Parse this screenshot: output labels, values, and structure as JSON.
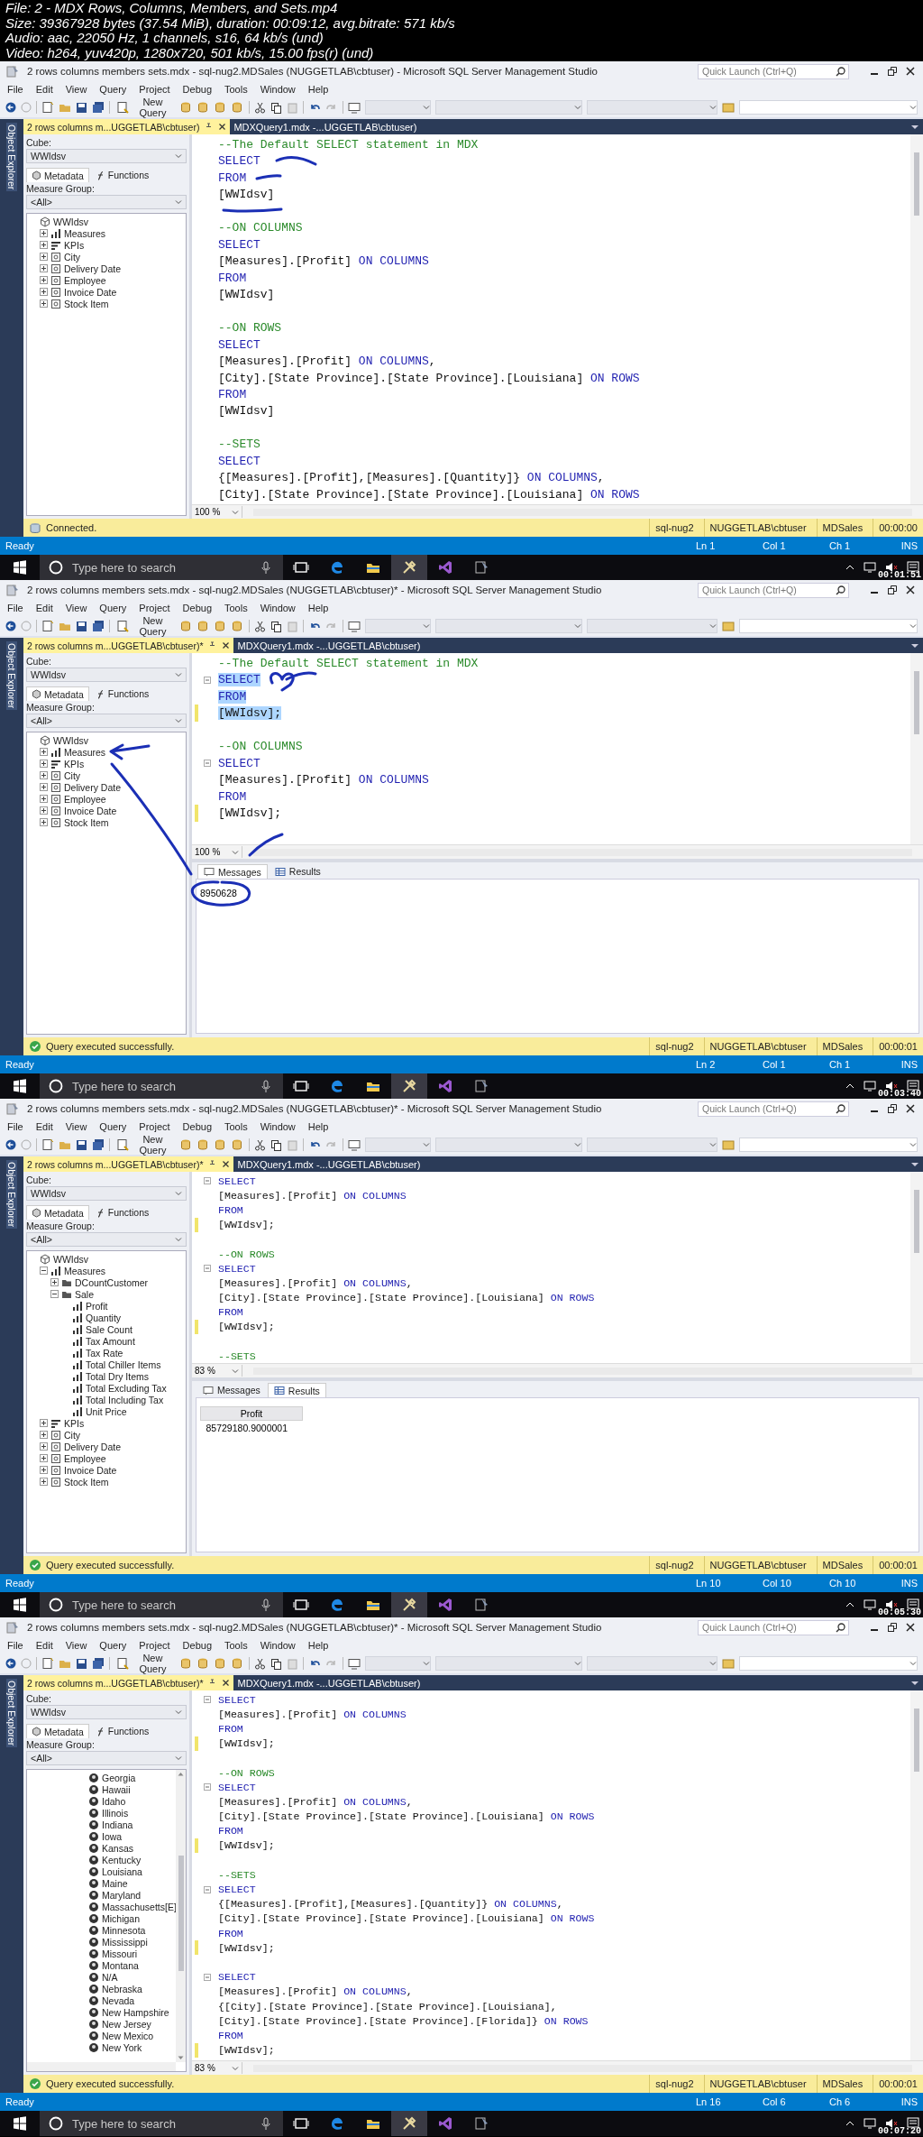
{
  "file_info": [
    "File: 2 - MDX Rows, Columns, Members, and Sets.mp4",
    "Size: 39367928 bytes (37.54 MiB), duration: 00:09:12, avg.bitrate: 571 kb/s",
    "Audio: aac, 22050 Hz, 1 channels, s16, 64 kb/s (und)",
    "Video: h264, yuv420p, 1280x720, 501 kb/s, 15.00 fps(r) (und)"
  ],
  "frames": [
    {
      "pen_marks": {
        "kind": "underlines"
      },
      "title": "2 rows columns members sets.mdx - sql-nug2.MDSales (NUGGETLAB\\cbtuser) - Microsoft SQL Server Management Studio",
      "quick_launch": {
        "placeholder": "Quick Launch (Ctrl+Q)"
      },
      "menu": [
        "File",
        "Edit",
        "View",
        "Query",
        "Project",
        "Debug",
        "Tools",
        "Window",
        "Help"
      ],
      "new_query": "New Query",
      "side_strip": "Object Explorer",
      "tabs": [
        {
          "label": "2 rows columns m...UGGETLAB\\cbtuser)",
          "selected": true
        },
        {
          "label": "MDXQuery1.mdx -...UGGETLAB\\cbtuser)",
          "selected": false
        }
      ],
      "panel": {
        "cube_label": "Cube:",
        "cube": "WWIdsv",
        "tabs": [
          {
            "label": "Metadata",
            "selected": true
          },
          {
            "label": "Functions",
            "selected": false
          }
        ],
        "group_label": "Measure Group:",
        "group": "<All>",
        "tree": [
          {
            "label": "WWIdsv",
            "kind": "cube",
            "children": [
              {
                "label": "Measures",
                "kind": "measures",
                "expanded": false
              },
              {
                "label": "KPIs",
                "kind": "kpi",
                "expanded": false
              },
              {
                "label": "City",
                "kind": "dimension",
                "expanded": false
              },
              {
                "label": "Delivery Date",
                "kind": "dimension",
                "expanded": false
              },
              {
                "label": "Employee",
                "kind": "dimension",
                "expanded": false
              },
              {
                "label": "Invoice Date",
                "kind": "dimension",
                "expanded": false
              },
              {
                "label": "Stock Item",
                "kind": "dimension",
                "expanded": false
              }
            ]
          }
        ]
      },
      "editor": {
        "zoom": "100 %",
        "lines": [
          {
            "kind": "code",
            "segments": [
              {
                "kind": "comment",
                "text": "--The Default SELECT statement in MDX"
              }
            ]
          },
          {
            "kind": "code",
            "segments": [
              {
                "kind": "keyword",
                "text": "SELECT"
              }
            ]
          },
          {
            "kind": "code",
            "segments": [
              {
                "kind": "keyword",
                "text": "FROM"
              }
            ]
          },
          {
            "kind": "code",
            "segments": [
              {
                "kind": "text",
                "text": "[WWIdsv]"
              }
            ]
          },
          {
            "kind": "blank"
          },
          {
            "kind": "code",
            "segments": [
              {
                "kind": "comment",
                "text": "--ON COLUMNS"
              }
            ]
          },
          {
            "kind": "code",
            "segments": [
              {
                "kind": "keyword",
                "text": "SELECT"
              }
            ]
          },
          {
            "kind": "code",
            "segments": [
              {
                "kind": "text",
                "text": "[Measures].[Profit] "
              },
              {
                "kind": "keyword",
                "text": "ON COLUMNS"
              }
            ]
          },
          {
            "kind": "code",
            "segments": [
              {
                "kind": "keyword",
                "text": "FROM"
              }
            ]
          },
          {
            "kind": "code",
            "segments": [
              {
                "kind": "text",
                "text": "[WWIdsv]"
              }
            ]
          },
          {
            "kind": "blank"
          },
          {
            "kind": "code",
            "segments": [
              {
                "kind": "comment",
                "text": "--ON ROWS"
              }
            ]
          },
          {
            "kind": "code",
            "segments": [
              {
                "kind": "keyword",
                "text": "SELECT"
              }
            ]
          },
          {
            "kind": "code",
            "segments": [
              {
                "kind": "text",
                "text": "[Measures].[Profit] "
              },
              {
                "kind": "keyword",
                "text": "ON COLUMNS"
              },
              {
                "kind": "text",
                "text": ","
              }
            ]
          },
          {
            "kind": "code",
            "segments": [
              {
                "kind": "text",
                "text": "[City].[State Province].[State Province].[Louisiana] "
              },
              {
                "kind": "keyword",
                "text": "ON ROWS"
              }
            ]
          },
          {
            "kind": "code",
            "segments": [
              {
                "kind": "keyword",
                "text": "FROM"
              }
            ]
          },
          {
            "kind": "code",
            "segments": [
              {
                "kind": "text",
                "text": "[WWIdsv]"
              }
            ]
          },
          {
            "kind": "blank"
          },
          {
            "kind": "code",
            "segments": [
              {
                "kind": "comment",
                "text": "--SETS"
              }
            ]
          },
          {
            "kind": "code",
            "segments": [
              {
                "kind": "keyword",
                "text": "SELECT"
              }
            ]
          },
          {
            "kind": "code",
            "segments": [
              {
                "kind": "text",
                "text": "{[Measures].[Profit],[Measures].[Quantity]} "
              },
              {
                "kind": "keyword",
                "text": "ON COLUMNS"
              },
              {
                "kind": "text",
                "text": ","
              }
            ]
          },
          {
            "kind": "code",
            "segments": [
              {
                "kind": "text",
                "text": "[City].[State Province].[State Province].[Louisiana] "
              },
              {
                "kind": "keyword",
                "text": "ON ROWS"
              }
            ]
          }
        ]
      },
      "status": {
        "kind": "connected",
        "text": "Connected.",
        "server": "sql-nug2",
        "user": "NUGGETLAB\\cbtuser",
        "database": "MDSales",
        "elapsed": "00:00:00"
      },
      "statusbar": {
        "state": "Ready",
        "line": "Ln 1",
        "col": "Col 1",
        "ch": "Ch 1",
        "mode": "INS"
      },
      "taskbar": {
        "search": {
          "placeholder": "Type here to search"
        },
        "timestamp": "00:01:51"
      }
    },
    {
      "pen_marks": {
        "kind": "arrows"
      },
      "title": "2 rows columns members sets.mdx - sql-nug2.MDSales (NUGGETLAB\\cbtuser)* - Microsoft SQL Server Management Studio",
      "quick_launch": {
        "placeholder": "Quick Launch (Ctrl+Q)"
      },
      "menu": [
        "File",
        "Edit",
        "View",
        "Query",
        "Project",
        "Debug",
        "Tools",
        "Window",
        "Help"
      ],
      "new_query": "New Query",
      "side_strip": "Object Explorer",
      "tabs": [
        {
          "label": "2 rows columns m...UGGETLAB\\cbtuser)*",
          "selected": true
        },
        {
          "label": "MDXQuery1.mdx -...UGGETLAB\\cbtuser)",
          "selected": false
        }
      ],
      "panel": {
        "cube_label": "Cube:",
        "cube": "WWIdsv",
        "tabs": [
          {
            "label": "Metadata",
            "selected": true
          },
          {
            "label": "Functions",
            "selected": false
          }
        ],
        "group_label": "Measure Group:",
        "group": "<All>",
        "tree": [
          {
            "label": "WWIdsv",
            "kind": "cube",
            "children": [
              {
                "label": "Measures",
                "kind": "measures",
                "expanded": false
              },
              {
                "label": "KPIs",
                "kind": "kpi",
                "expanded": false
              },
              {
                "label": "City",
                "kind": "dimension",
                "expanded": false
              },
              {
                "label": "Delivery Date",
                "kind": "dimension",
                "expanded": false
              },
              {
                "label": "Employee",
                "kind": "dimension",
                "expanded": false
              },
              {
                "label": "Invoice Date",
                "kind": "dimension",
                "expanded": false
              },
              {
                "label": "Stock Item",
                "kind": "dimension",
                "expanded": false
              }
            ]
          }
        ]
      },
      "editor": {
        "zoom": "100 %",
        "lines": [
          {
            "kind": "code",
            "selected": false,
            "segments": [
              {
                "kind": "comment",
                "text": "--The Default SELECT statement in MDX"
              }
            ]
          },
          {
            "kind": "code",
            "selected": true,
            "fold": true,
            "segments": [
              {
                "kind": "keyword",
                "text": "SELECT"
              }
            ]
          },
          {
            "kind": "code",
            "selected": true,
            "segments": [
              {
                "kind": "keyword",
                "text": "FROM"
              }
            ]
          },
          {
            "kind": "code",
            "selected": true,
            "modified": true,
            "segments": [
              {
                "kind": "text",
                "text": "[WWIdsv];"
              }
            ]
          },
          {
            "kind": "blank"
          },
          {
            "kind": "code",
            "selected": false,
            "segments": [
              {
                "kind": "comment",
                "text": "--ON COLUMNS"
              }
            ]
          },
          {
            "kind": "code",
            "selected": false,
            "fold": true,
            "segments": [
              {
                "kind": "keyword",
                "text": "SELECT"
              }
            ]
          },
          {
            "kind": "code",
            "selected": false,
            "segments": [
              {
                "kind": "text",
                "text": "[Measures].[Profit] "
              },
              {
                "kind": "keyword",
                "text": "ON COLUMNS"
              }
            ]
          },
          {
            "kind": "code",
            "selected": false,
            "segments": [
              {
                "kind": "keyword",
                "text": "FROM"
              }
            ]
          },
          {
            "kind": "code",
            "selected": false,
            "modified": true,
            "segments": [
              {
                "kind": "text",
                "text": "[WWIdsv];"
              }
            ]
          }
        ]
      },
      "results": {
        "kind": "messages",
        "tabs": [
          {
            "label": "Messages",
            "selected": true
          },
          {
            "label": "Results",
            "selected": false
          }
        ],
        "message": "8950628"
      },
      "status": {
        "kind": "success",
        "text": "Query executed successfully.",
        "server": "sql-nug2",
        "user": "NUGGETLAB\\cbtuser",
        "database": "MDSales",
        "elapsed": "00:00:01"
      },
      "statusbar": {
        "state": "Ready",
        "line": "Ln 2",
        "col": "Col 1",
        "ch": "Ch 1",
        "mode": "INS"
      },
      "taskbar": {
        "search": {
          "placeholder": "Type here to search"
        },
        "timestamp": "00:03:40"
      }
    },
    {
      "title": "2 rows columns members sets.mdx - sql-nug2.MDSales (NUGGETLAB\\cbtuser)* - Microsoft SQL Server Management Studio",
      "quick_launch": {
        "placeholder": "Quick Launch (Ctrl+Q)"
      },
      "menu": [
        "File",
        "Edit",
        "View",
        "Query",
        "Project",
        "Debug",
        "Tools",
        "Window",
        "Help"
      ],
      "new_query": "New Query",
      "side_strip": "Object Explorer",
      "tabs": [
        {
          "label": "2 rows columns m...UGGETLAB\\cbtuser)*",
          "selected": true
        },
        {
          "label": "MDXQuery1.mdx -...UGGETLAB\\cbtuser)",
          "selected": false
        }
      ],
      "panel": {
        "cube_label": "Cube:",
        "cube": "WWIdsv",
        "tabs": [
          {
            "label": "Metadata",
            "selected": true
          },
          {
            "label": "Functions",
            "selected": false
          }
        ],
        "group_label": "Measure Group:",
        "group": "<All>",
        "tree": [
          {
            "label": "WWIdsv",
            "kind": "cube",
            "children": [
              {
                "label": "Measures",
                "kind": "measures",
                "expanded": true,
                "children": [
                  {
                    "label": "DCountCustomer",
                    "kind": "folder",
                    "expanded": false
                  },
                  {
                    "label": "Sale",
                    "kind": "folder",
                    "expanded": true,
                    "children": [
                      {
                        "label": "Profit",
                        "kind": "measure"
                      },
                      {
                        "label": "Quantity",
                        "kind": "measure"
                      },
                      {
                        "label": "Sale Count",
                        "kind": "measure"
                      },
                      {
                        "label": "Tax Amount",
                        "kind": "measure"
                      },
                      {
                        "label": "Tax Rate",
                        "kind": "measure"
                      },
                      {
                        "label": "Total Chiller Items",
                        "kind": "measure"
                      },
                      {
                        "label": "Total Dry Items",
                        "kind": "measure"
                      },
                      {
                        "label": "Total Excluding Tax",
                        "kind": "measure"
                      },
                      {
                        "label": "Total Including Tax",
                        "kind": "measure"
                      },
                      {
                        "label": "Unit Price",
                        "kind": "measure"
                      }
                    ]
                  }
                ]
              },
              {
                "label": "KPIs",
                "kind": "kpi",
                "expanded": false
              },
              {
                "label": "City",
                "kind": "dimension",
                "expanded": false
              },
              {
                "label": "Delivery Date",
                "kind": "dimension",
                "expanded": false
              },
              {
                "label": "Employee",
                "kind": "dimension",
                "expanded": false
              },
              {
                "label": "Invoice Date",
                "kind": "dimension",
                "expanded": false
              },
              {
                "label": "Stock Item",
                "kind": "dimension",
                "expanded": false
              }
            ]
          }
        ]
      },
      "editor": {
        "zoom": "83 %",
        "lines": [
          {
            "kind": "code",
            "fold": true,
            "segments": [
              {
                "kind": "keyword",
                "text": "SELECT"
              }
            ]
          },
          {
            "kind": "code",
            "segments": [
              {
                "kind": "text",
                "text": "[Measures].[Profit] "
              },
              {
                "kind": "keyword",
                "text": "ON COLUMNS"
              }
            ]
          },
          {
            "kind": "code",
            "segments": [
              {
                "kind": "keyword",
                "text": "FROM"
              }
            ]
          },
          {
            "kind": "code",
            "modified": true,
            "segments": [
              {
                "kind": "text",
                "text": "[WWIdsv];"
              }
            ]
          },
          {
            "kind": "blank"
          },
          {
            "kind": "code",
            "segments": [
              {
                "kind": "comment",
                "text": "--ON ROWS"
              }
            ]
          },
          {
            "kind": "code",
            "fold": true,
            "segments": [
              {
                "kind": "keyword",
                "text": "SELECT"
              }
            ]
          },
          {
            "kind": "code",
            "segments": [
              {
                "kind": "text",
                "text": "[Measures].[Profit] "
              },
              {
                "kind": "keyword",
                "text": "ON COLUMNS"
              },
              {
                "kind": "text",
                "text": ","
              }
            ]
          },
          {
            "kind": "code",
            "segments": [
              {
                "kind": "text",
                "text": "[City].[State Province].[State Province].[Louisiana] "
              },
              {
                "kind": "keyword",
                "text": "ON ROWS"
              }
            ]
          },
          {
            "kind": "code",
            "segments": [
              {
                "kind": "keyword",
                "text": "FROM"
              }
            ]
          },
          {
            "kind": "code",
            "modified": true,
            "segments": [
              {
                "kind": "text",
                "text": "[WWIdsv];"
              }
            ]
          },
          {
            "kind": "blank"
          },
          {
            "kind": "code",
            "segments": [
              {
                "kind": "comment",
                "text": "--SETS"
              }
            ]
          }
        ]
      },
      "results": {
        "kind": "grid",
        "tabs": [
          {
            "label": "Messages",
            "selected": false
          },
          {
            "label": "Results",
            "selected": true
          }
        ],
        "columns": [
          "Profit"
        ],
        "rows": [
          [
            "85729180.9000001"
          ]
        ]
      },
      "status": {
        "kind": "success",
        "text": "Query executed successfully.",
        "server": "sql-nug2",
        "user": "NUGGETLAB\\cbtuser",
        "database": "MDSales",
        "elapsed": "00:00:01"
      },
      "statusbar": {
        "state": "Ready",
        "line": "Ln 10",
        "col": "Col 10",
        "ch": "Ch 10",
        "mode": "INS"
      },
      "taskbar": {
        "search": {
          "placeholder": "Type here to search"
        },
        "timestamp": "00:05:30"
      }
    },
    {
      "title": "2 rows columns members sets.mdx - sql-nug2.MDSales (NUGGETLAB\\cbtuser)* - Microsoft SQL Server Management Studio",
      "quick_launch": {
        "placeholder": "Quick Launch (Ctrl+Q)"
      },
      "menu": [
        "File",
        "Edit",
        "View",
        "Query",
        "Project",
        "Debug",
        "Tools",
        "Window",
        "Help"
      ],
      "new_query": "New Query",
      "side_strip": "Object Explorer",
      "tabs": [
        {
          "label": "2 rows columns m...UGGETLAB\\cbtuser)*",
          "selected": true
        },
        {
          "label": "MDXQuery1.mdx -...UGGETLAB\\cbtuser)",
          "selected": false
        }
      ],
      "panel": {
        "cube_label": "Cube:",
        "cube": "WWIdsv",
        "tabs": [
          {
            "label": "Metadata",
            "selected": true
          },
          {
            "label": "Functions",
            "selected": false
          }
        ],
        "group_label": "Measure Group:",
        "group": "<All>",
        "scrollbars": true,
        "tree": [
          {
            "label": "Georgia",
            "kind": "member"
          },
          {
            "label": "Hawaii",
            "kind": "member"
          },
          {
            "label": "Idaho",
            "kind": "member"
          },
          {
            "label": "Illinois",
            "kind": "member"
          },
          {
            "label": "Indiana",
            "kind": "member"
          },
          {
            "label": "Iowa",
            "kind": "member"
          },
          {
            "label": "Kansas",
            "kind": "member"
          },
          {
            "label": "Kentucky",
            "kind": "member"
          },
          {
            "label": "Louisiana",
            "kind": "member"
          },
          {
            "label": "Maine",
            "kind": "member"
          },
          {
            "label": "Maryland",
            "kind": "member"
          },
          {
            "label": "Massachusetts[E]",
            "kind": "member"
          },
          {
            "label": "Michigan",
            "kind": "member"
          },
          {
            "label": "Minnesota",
            "kind": "member"
          },
          {
            "label": "Mississippi",
            "kind": "member"
          },
          {
            "label": "Missouri",
            "kind": "member"
          },
          {
            "label": "Montana",
            "kind": "member"
          },
          {
            "label": "N/A",
            "kind": "member"
          },
          {
            "label": "Nebraska",
            "kind": "member"
          },
          {
            "label": "Nevada",
            "kind": "member"
          },
          {
            "label": "New Hampshire",
            "kind": "member"
          },
          {
            "label": "New Jersey",
            "kind": "member"
          },
          {
            "label": "New Mexico",
            "kind": "member"
          },
          {
            "label": "New York",
            "kind": "member"
          }
        ]
      },
      "editor": {
        "zoom": "83 %",
        "lines": [
          {
            "kind": "code",
            "fold": true,
            "segments": [
              {
                "kind": "keyword",
                "text": "SELECT"
              }
            ]
          },
          {
            "kind": "code",
            "segments": [
              {
                "kind": "text",
                "text": "[Measures].[Profit] "
              },
              {
                "kind": "keyword",
                "text": "ON COLUMNS"
              }
            ]
          },
          {
            "kind": "code",
            "segments": [
              {
                "kind": "keyword",
                "text": "FROM"
              }
            ]
          },
          {
            "kind": "code",
            "modified": true,
            "segments": [
              {
                "kind": "text",
                "text": "[WWIdsv];"
              }
            ]
          },
          {
            "kind": "blank"
          },
          {
            "kind": "code",
            "segments": [
              {
                "kind": "comment",
                "text": "--ON ROWS"
              }
            ]
          },
          {
            "kind": "code",
            "fold": true,
            "segments": [
              {
                "kind": "keyword",
                "text": "SELECT"
              }
            ]
          },
          {
            "kind": "code",
            "segments": [
              {
                "kind": "text",
                "text": "[Measures].[Profit] "
              },
              {
                "kind": "keyword",
                "text": "ON COLUMNS"
              },
              {
                "kind": "text",
                "text": ","
              }
            ]
          },
          {
            "kind": "code",
            "segments": [
              {
                "kind": "text",
                "text": "[City].[State Province].[State Province].[Louisiana] "
              },
              {
                "kind": "keyword",
                "text": "ON ROWS"
              }
            ]
          },
          {
            "kind": "code",
            "segments": [
              {
                "kind": "keyword",
                "text": "FROM"
              }
            ]
          },
          {
            "kind": "code",
            "modified": true,
            "segments": [
              {
                "kind": "text",
                "text": "[WWIdsv];"
              }
            ]
          },
          {
            "kind": "blank"
          },
          {
            "kind": "code",
            "segments": [
              {
                "kind": "comment",
                "text": "--SETS"
              }
            ]
          },
          {
            "kind": "code",
            "fold": true,
            "segments": [
              {
                "kind": "keyword",
                "text": "SELECT"
              }
            ]
          },
          {
            "kind": "code",
            "segments": [
              {
                "kind": "text",
                "text": "{[Measures].[Profit],[Measures].[Quantity]} "
              },
              {
                "kind": "keyword",
                "text": "ON COLUMNS"
              },
              {
                "kind": "text",
                "text": ","
              }
            ]
          },
          {
            "kind": "code",
            "segments": [
              {
                "kind": "text",
                "text": "[City].[State Province].[State Province].[Louisiana] "
              },
              {
                "kind": "keyword",
                "text": "ON ROWS"
              }
            ]
          },
          {
            "kind": "code",
            "segments": [
              {
                "kind": "keyword",
                "text": "FROM"
              }
            ]
          },
          {
            "kind": "code",
            "modified": true,
            "segments": [
              {
                "kind": "text",
                "text": "[WWIdsv];"
              }
            ]
          },
          {
            "kind": "blank"
          },
          {
            "kind": "code",
            "fold": true,
            "segments": [
              {
                "kind": "keyword",
                "text": "SELECT"
              }
            ]
          },
          {
            "kind": "code",
            "segments": [
              {
                "kind": "text",
                "text": "[Measures].[Profit] "
              },
              {
                "kind": "keyword",
                "text": "ON COLUMNS"
              },
              {
                "kind": "text",
                "text": ","
              }
            ]
          },
          {
            "kind": "code",
            "segments": [
              {
                "kind": "text",
                "text": "{[City].[State Province].[State Province].[Louisiana],"
              }
            ]
          },
          {
            "kind": "code",
            "segments": [
              {
                "kind": "text",
                "text": "[City].[State Province].[State Province].[Florida]} "
              },
              {
                "kind": "keyword",
                "text": "ON ROWS"
              }
            ]
          },
          {
            "kind": "code",
            "segments": [
              {
                "kind": "keyword",
                "text": "FROM"
              }
            ]
          },
          {
            "kind": "code",
            "modified": true,
            "segments": [
              {
                "kind": "text",
                "text": "[WWIdsv];"
              }
            ]
          }
        ]
      },
      "status": {
        "kind": "success",
        "text": "Query executed successfully.",
        "server": "sql-nug2",
        "user": "NUGGETLAB\\cbtuser",
        "database": "MDSales",
        "elapsed": "00:00:01"
      },
      "statusbar": {
        "state": "Ready",
        "line": "Ln 16",
        "col": "Col 6",
        "ch": "Ch 6",
        "mode": "INS"
      },
      "taskbar": {
        "search": {
          "placeholder": "Type here to search"
        },
        "timestamp": "00:07:20"
      }
    }
  ]
}
